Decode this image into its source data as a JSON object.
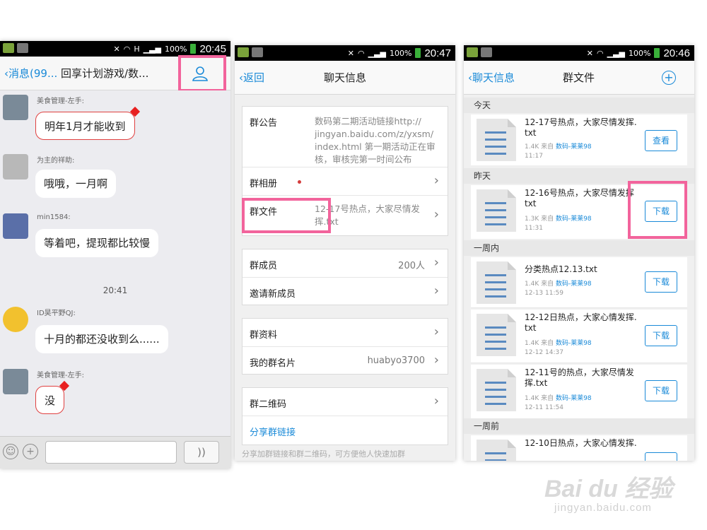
{
  "screen1": {
    "status_time": "20:45",
    "status_battery": "100%",
    "status_h": "H",
    "back_label": "消息(99...",
    "title": "回享计划游戏/数...",
    "messages": [
      {
        "sender": "美食管理-左手:",
        "text": "明年1月才能收到"
      },
      {
        "sender": "为主的祥助:",
        "text": "哦哦，一月啊"
      },
      {
        "sender": "min1584:",
        "text": "等着吧，提现都比较慢"
      },
      {
        "sender": "ID昊平野QJ:",
        "text": "十月的都还没收到么......"
      },
      {
        "sender": "美食管理-左手:",
        "text": "没"
      }
    ],
    "time_divider": "20:41",
    "emoji_btn": "☺",
    "plus_btn": "+",
    "voice_btn": "))"
  },
  "screen2": {
    "status_time": "20:47",
    "status_battery": "100%",
    "back_label": "返回",
    "title": "聊天信息",
    "rows": {
      "notice_label": "群公告",
      "notice_text": "数码第二期活动链接http://\njingyan.baidu.com/z/yxsm/\nindex.html 第一期活动正在审\n核，审核完第一时间公布",
      "album_label": "群相册",
      "files_label": "群文件",
      "files_value": "12-17号热点，大家尽情发\n挥.txt",
      "members_label": "群成员",
      "members_value": "200人",
      "invite_label": "邀请新成员",
      "profile_label": "群资料",
      "card_label": "我的群名片",
      "card_value": "huabyo3700",
      "qr_label": "群二维码",
      "share_label": "分享群链接",
      "share_desc": "分享加群链接和群二维码，可方便他人快速加群"
    }
  },
  "screen3": {
    "status_time": "20:46",
    "status_battery": "100%",
    "back_label": "聊天信息",
    "title": "群文件",
    "add_icon": "+",
    "sections": [
      "今天",
      "昨天",
      "一周内",
      "一周前"
    ],
    "files": [
      {
        "name": "12-17号热点，大家尽情发挥.\ntxt",
        "size": "1.4K 来自",
        "from": "数码-莱莱98",
        "date": "11:17",
        "action": "查看"
      },
      {
        "name": "12-16号热点，大家尽情发挥\ntxt",
        "size": "1.3K 来自",
        "from": "数码-莱莱98",
        "date": "11:31",
        "action": "下载"
      },
      {
        "name": "分类热点12.13.txt",
        "size": "1.4K 来自",
        "from": "数码-莱莱98",
        "date": "12-13 11:59",
        "action": "下载"
      },
      {
        "name": "12-12日热点，大家心情发挥.\ntxt",
        "size": "1.4K 来自",
        "from": "数码-莱莱98",
        "date": "12-12 14:37",
        "action": "下载"
      },
      {
        "name": "12-11号的热点，大家尽情发\n挥.txt",
        "size": "1.4K 来自",
        "from": "数码-莱莱98",
        "date": "12-11 11:54",
        "action": "下载"
      },
      {
        "name": "12-10日热点，大家心情发挥."
      }
    ]
  },
  "watermark": {
    "main": "Bai du 经验",
    "sub": "jingyan.baidu.com"
  },
  "colors": {
    "highlight": "#f2649c",
    "link": "#1a8ad8"
  }
}
